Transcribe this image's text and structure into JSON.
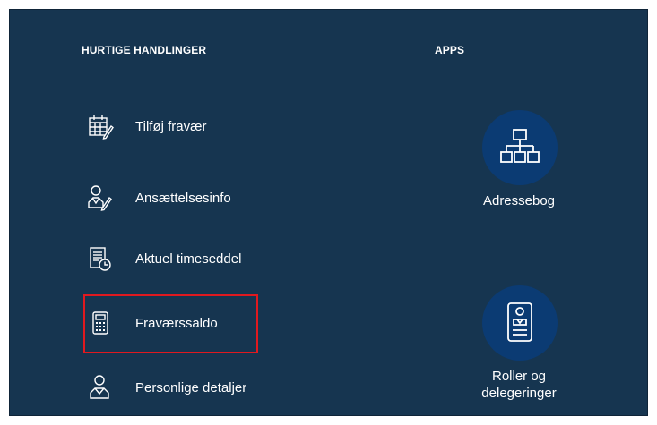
{
  "quick_actions": {
    "title": "HURTIGE HANDLINGER",
    "items": [
      {
        "label": "Tilføj fravær",
        "icon": "calendar-pencil-icon"
      },
      {
        "label": "Ansættelsesinfo",
        "icon": "person-pencil-icon"
      },
      {
        "label": "Aktuel timeseddel",
        "icon": "document-clock-icon"
      },
      {
        "label": "Fraværssaldo",
        "icon": "calculator-icon"
      },
      {
        "label": "Personlige detaljer",
        "icon": "person-icon"
      }
    ]
  },
  "apps": {
    "title": "APPS",
    "items": [
      {
        "label": "Adressebog",
        "icon": "org-chart-icon"
      },
      {
        "label": "Roller og delegeringer",
        "icon": "id-badge-icon"
      }
    ]
  },
  "colors": {
    "background": "#163550",
    "app_circle": "#0b3b73",
    "highlight": "#e0191f"
  }
}
